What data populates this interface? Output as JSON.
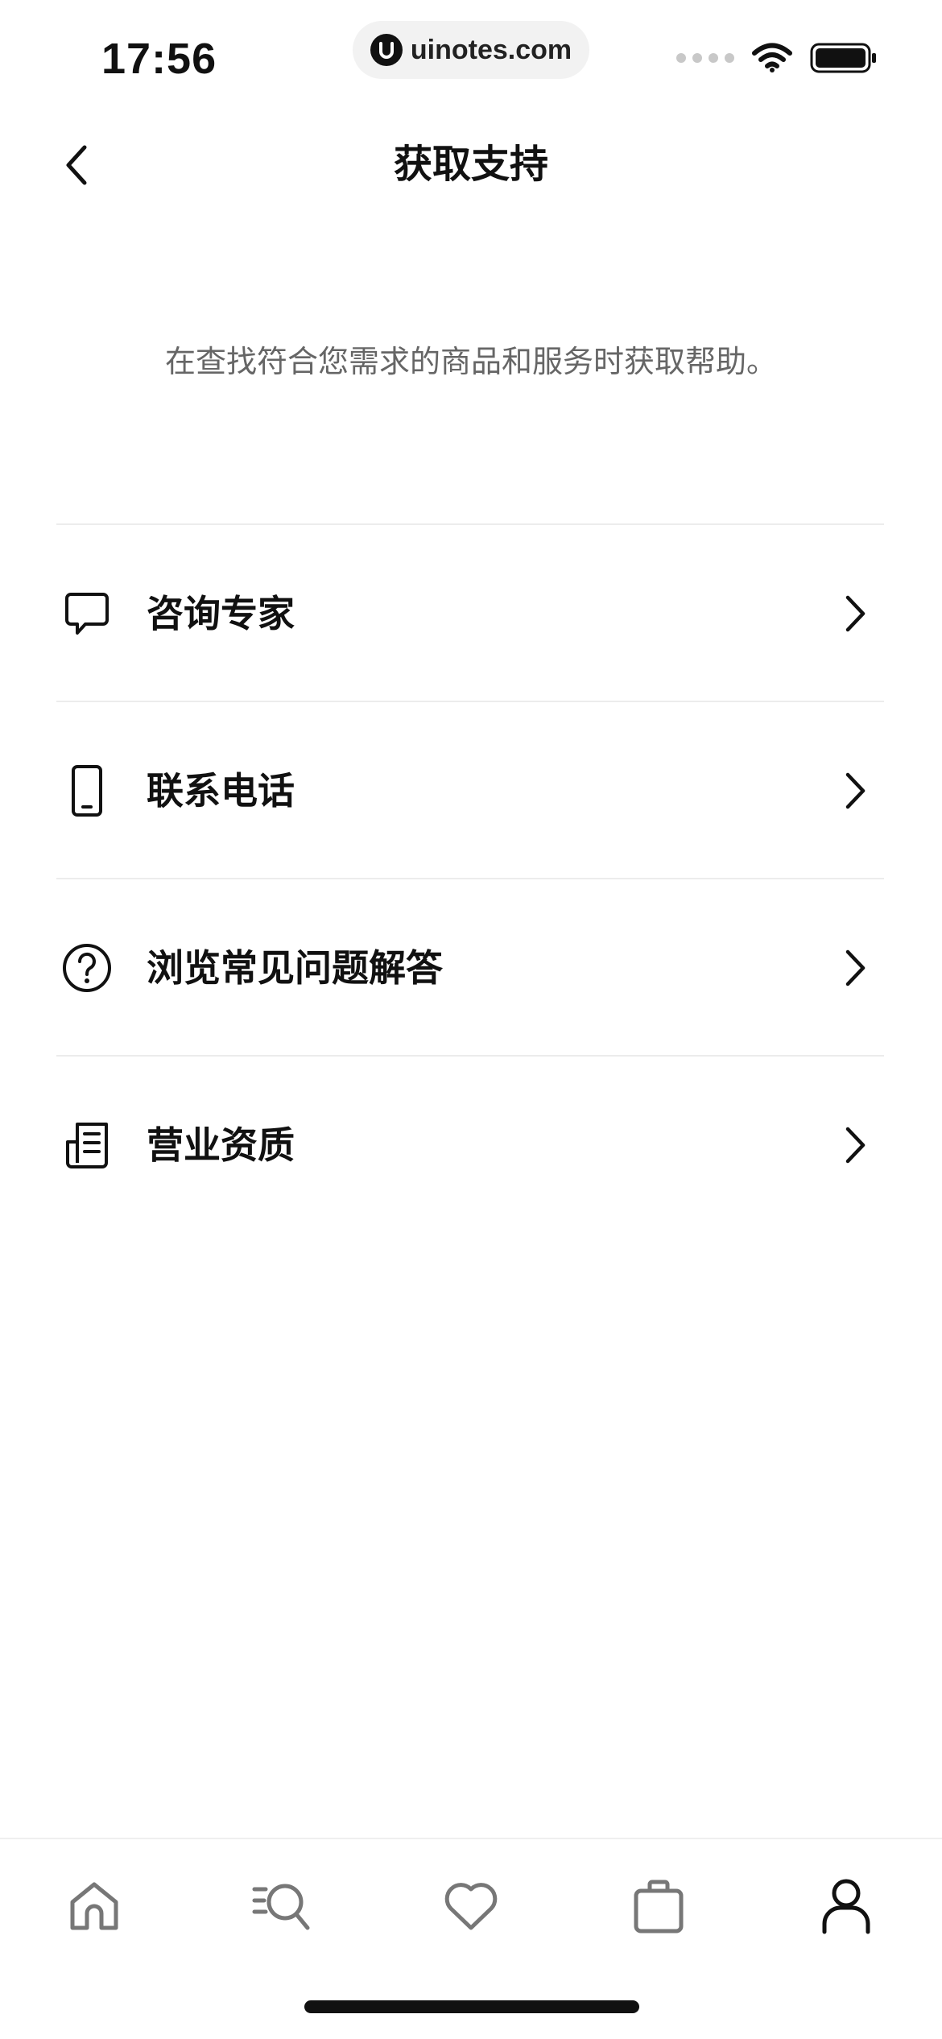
{
  "status_bar": {
    "time": "17:56",
    "url": "uinotes.com"
  },
  "nav": {
    "title": "获取支持"
  },
  "intro": "在查找符合您需求的商品和服务时获取帮助。",
  "support_items": [
    {
      "label": "咨询专家",
      "icon": "chat-bubble-icon"
    },
    {
      "label": "联系电话",
      "icon": "phone-icon"
    },
    {
      "label": "浏览常见问题解答",
      "icon": "question-circle-icon"
    },
    {
      "label": "营业资质",
      "icon": "document-icon"
    }
  ],
  "tab_bar": {
    "tabs": [
      {
        "icon": "home-icon",
        "active": false
      },
      {
        "icon": "search-list-icon",
        "active": false
      },
      {
        "icon": "heart-icon",
        "active": false
      },
      {
        "icon": "bag-icon",
        "active": false
      },
      {
        "icon": "profile-icon",
        "active": true
      }
    ]
  },
  "colors": {
    "text": "#111111",
    "secondary_text": "#666666",
    "divider": "#ececec",
    "inactive_tab": "#777777"
  }
}
